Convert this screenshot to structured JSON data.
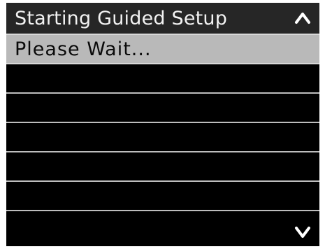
{
  "header": {
    "title": "Starting Guided Setup",
    "scroll_up_icon": "chevron-up-icon"
  },
  "list": {
    "items": [
      {
        "label": "Please Wait..."
      },
      {
        "label": ""
      },
      {
        "label": ""
      },
      {
        "label": ""
      },
      {
        "label": ""
      },
      {
        "label": ""
      },
      {
        "label": ""
      }
    ]
  },
  "footer": {
    "scroll_down_icon": "chevron-down-icon"
  },
  "colors": {
    "background": "#000000",
    "title_bar": "#262626",
    "selected_row": "#b9b9b9",
    "text_light": "#f2f2f2",
    "text_dark": "#0b0b0b"
  }
}
